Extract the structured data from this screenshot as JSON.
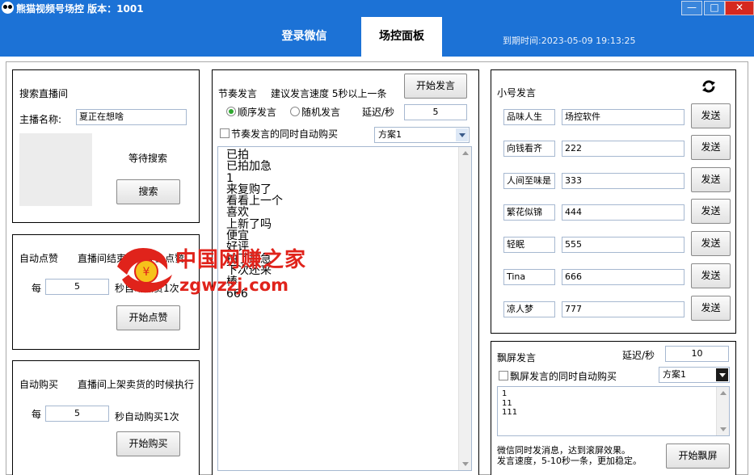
{
  "window": {
    "title": "熊猫视频号场控   版本：1001",
    "controls": {
      "minimize": "—",
      "maximize": "□",
      "close": "✕"
    }
  },
  "tabs": [
    {
      "label": "登录微信",
      "active": false
    },
    {
      "label": "场控面板",
      "active": true
    }
  ],
  "expire": "到期时间:2023-05-09 19:13:25",
  "search": {
    "title": "搜索直播间",
    "host_label": "主播名称:",
    "host_value": "夏正在想啥",
    "status": "等待搜索",
    "button": "搜索"
  },
  "auto_like": {
    "title": "自动点赞",
    "note": "直播间结束时候停止点赞",
    "every": "每",
    "value": "5",
    "unit": "秒自动点赞1次",
    "button": "开始点赞"
  },
  "auto_buy": {
    "title": "自动购买",
    "note": "直播间上架卖货的时候执行",
    "every": "每",
    "value": "5",
    "unit": "秒自动购买1次",
    "button": "开始购买"
  },
  "rhythm": {
    "title": "节奏发言",
    "hint": "建议发言速度 5秒以上一条",
    "button": "开始发言",
    "radio_order": "顺序发言",
    "radio_random": "随机发言",
    "order_selected": true,
    "delay_label": "延迟/秒",
    "delay_value": "5",
    "autobuy_label": "节奏发言的同时自动购买",
    "plan": "方案1",
    "lines": [
      "已拍",
      "已拍加急",
      "1",
      "来复购了",
      "看看上一个",
      "喜欢",
      "上新了吗",
      "便宜",
      "好评",
      "拍了加急",
      "下次还来",
      "棒",
      "666"
    ]
  },
  "alt_accounts": {
    "title": "小号发言",
    "send_label": "发送",
    "rows": [
      {
        "name": "品味人生",
        "message": "场控软件"
      },
      {
        "name": "向钱看齐",
        "message": "222"
      },
      {
        "name": "人间至味是",
        "message": "333"
      },
      {
        "name": "繁花似锦",
        "message": "444"
      },
      {
        "name": "轻眠",
        "message": "555"
      },
      {
        "name": "Tina",
        "message": "666"
      },
      {
        "name": "凉人梦",
        "message": "777"
      }
    ]
  },
  "screen": {
    "title": "飘屏发言",
    "delay_label": "延迟/秒",
    "delay_value": "10",
    "autobuy_label": "飘屏发言的同时自动购买",
    "plan": "方案1",
    "lines": [
      "1",
      "11",
      "111"
    ],
    "note1": "微信同时发消息，达到滚屏效果。",
    "note2": "发言速度，5-10秒一条，更加稳定。",
    "button": "开始飘屏"
  },
  "watermark": {
    "name": "中国网赚之家",
    "url": "zgwzzj.com"
  },
  "colors": {
    "title_bar": "#1c72d6",
    "radio_on": "#2fa82f",
    "watermark": "#e0231b",
    "close": "#d5281f"
  }
}
